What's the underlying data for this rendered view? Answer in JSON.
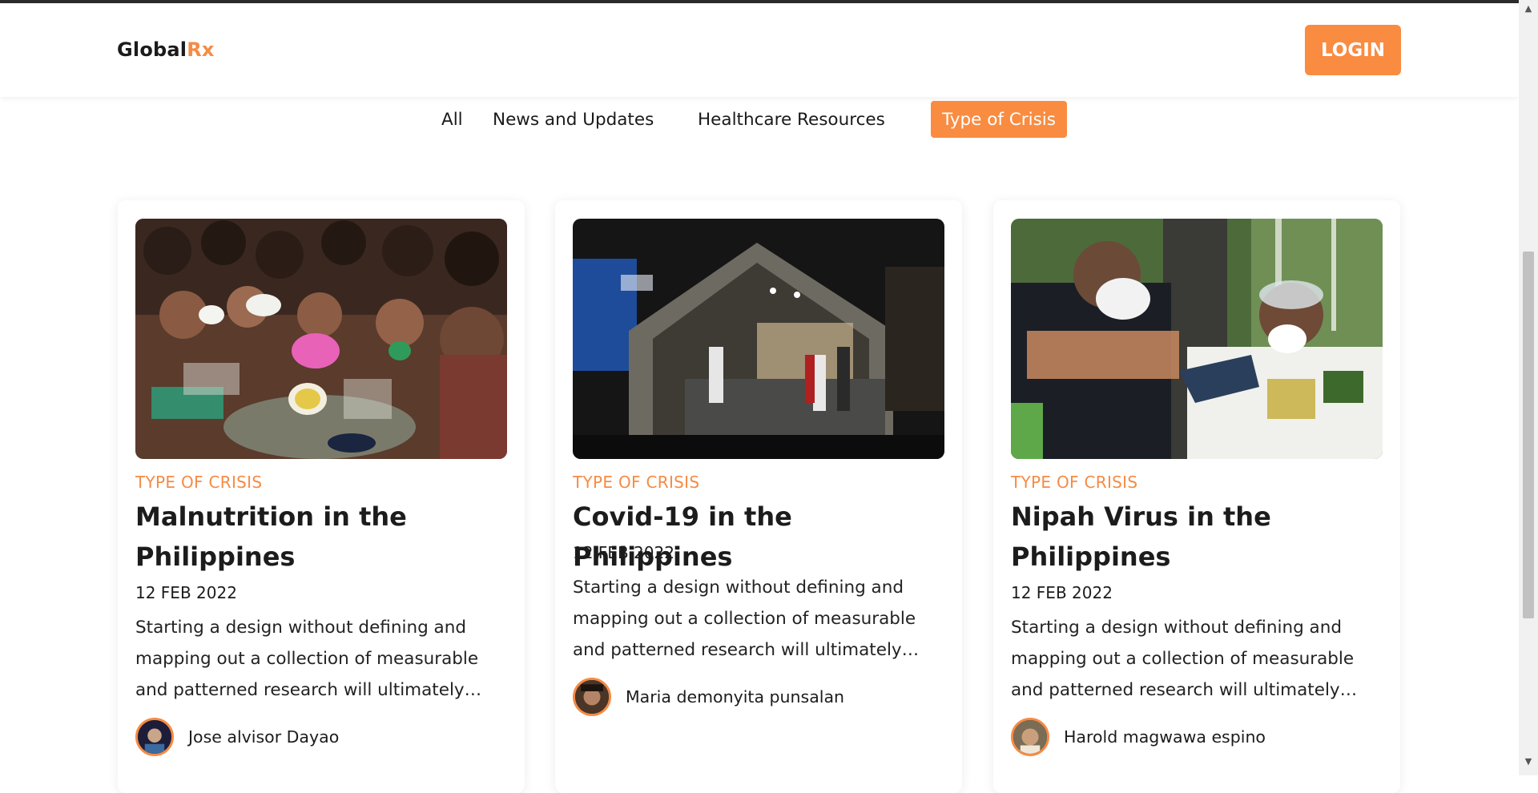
{
  "header": {
    "logo_part1": "Global",
    "logo_part2": "Rx",
    "login_label": "LOGIN"
  },
  "tabs": [
    {
      "label": "All",
      "active": false
    },
    {
      "label": "News and Updates",
      "active": false
    },
    {
      "label": "Healthcare Resources",
      "active": false
    },
    {
      "label": "Type of Crisis",
      "active": true
    }
  ],
  "cards": [
    {
      "category": "TYPE OF CRISIS",
      "title": "Malnutrition in the Philippines",
      "date": "12 FEB 2022",
      "excerpt": "Starting a design without defining and mapping out a collection of measurable and patterned research will ultimately…",
      "author": "Jose alvisor Dayao",
      "image": "children-with-bowls-photo"
    },
    {
      "category": "TYPE OF CRISIS",
      "title": "Covid-19 in the Philippines",
      "date": "12 FEB 2022",
      "excerpt": "Starting a design without defining and mapping out a collection of measurable and patterned research will ultimately…",
      "author": "Maria demonyita punsalan",
      "image": "hospital-tent-photo"
    },
    {
      "category": "TYPE OF CRISIS",
      "title": "Nipah Virus in the Philippines",
      "date": "12 FEB 2022",
      "excerpt": "Starting a design without defining and mapping out a collection of measurable and patterned research will ultimately…",
      "author": "Harold magwawa espino",
      "image": "health-workers-masks-photo"
    }
  ],
  "colors": {
    "accent": "#f98c40",
    "category": "#f58b45",
    "text": "#1c1c1c"
  }
}
